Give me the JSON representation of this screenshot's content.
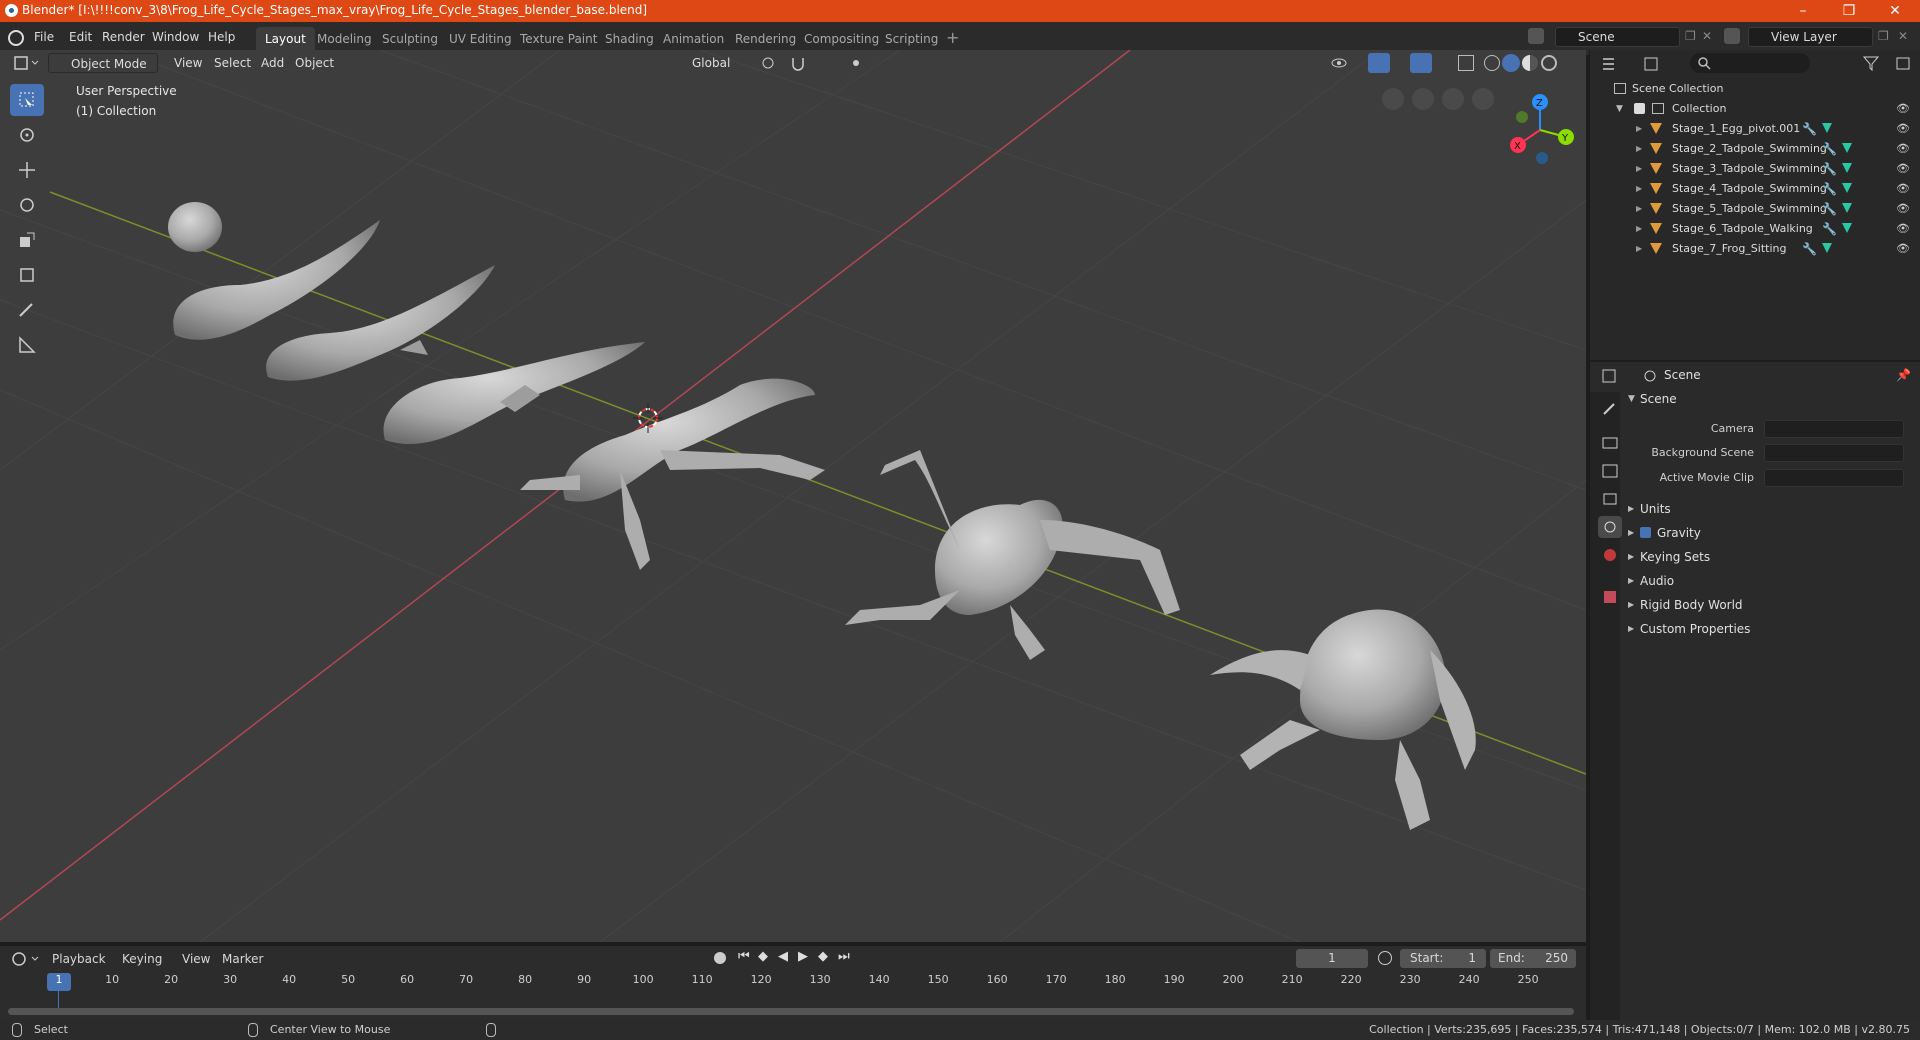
{
  "window": {
    "title": "Blender* [I:\\!!!!conv_3\\8\\Frog_Life_Cycle_Stages_max_vray\\Frog_Life_Cycle_Stages_blender_base.blend]",
    "minimize": "–",
    "maximize": "❐",
    "close": "✕"
  },
  "menu": {
    "items": [
      "File",
      "Edit",
      "Render",
      "Window",
      "Help"
    ]
  },
  "workspaces": [
    "Layout",
    "Modeling",
    "Sculpting",
    "UV Editing",
    "Texture Paint",
    "Shading",
    "Animation",
    "Rendering",
    "Compositing",
    "Scripting"
  ],
  "workspace_add": "+",
  "scene_selector": {
    "value": "Scene"
  },
  "view_layer_selector": {
    "value": "View Layer"
  },
  "viewport_header": {
    "mode": "Object Mode",
    "menus": [
      "View",
      "Select",
      "Add",
      "Object"
    ],
    "transform_orientation": "Global"
  },
  "viewport": {
    "perspective_label": "User Perspective",
    "collection_label": "(1) Collection",
    "gizmo_axes": {
      "x": "X",
      "y": "Y",
      "z": "Z"
    }
  },
  "timeline": {
    "menus": [
      "Playback",
      "Keying",
      "View",
      "Marker"
    ],
    "current_frame": "1",
    "start_label": "Start:",
    "start_value": "1",
    "end_label": "End:",
    "end_value": "250",
    "ticks": [
      "1",
      "10",
      "20",
      "30",
      "40",
      "50",
      "60",
      "70",
      "80",
      "90",
      "100",
      "110",
      "120",
      "130",
      "140",
      "150",
      "160",
      "170",
      "180",
      "190",
      "200",
      "210",
      "220",
      "230",
      "240",
      "250"
    ]
  },
  "outliner": {
    "root": "Scene Collection",
    "collection": "Collection",
    "objects": [
      "Stage_1_Egg_pivot.001",
      "Stage_2_Tadpole_Swimming",
      "Stage_3_Tadpole_Swimming",
      "Stage_4_Tadpole_Swimming",
      "Stage_5_Tadpole_Swimming",
      "Stage_6_Tadpole_Walking",
      "Stage_7_Frog_Sitting"
    ]
  },
  "properties": {
    "context": "Scene",
    "panel_title": "Scene",
    "camera_label": "Camera",
    "background_scene_label": "Background Scene",
    "active_movie_clip_label": "Active Movie Clip",
    "sections": [
      "Units",
      "Gravity",
      "Keying Sets",
      "Audio",
      "Rigid Body World",
      "Custom Properties"
    ]
  },
  "statusbar": {
    "left_action": "Select",
    "middle_action": "Center View to Mouse",
    "stats": "Collection | Verts:235,695 | Faces:235,574 | Tris:471,148 | Objects:0/7 | Mem: 102.0 MB | v2.80.75"
  },
  "colors": {
    "title_bar": "#dd4814",
    "active_tool": "#4772b3",
    "axis_x": "#ff3352",
    "axis_y": "#8bdc00",
    "axis_z": "#2890ff",
    "timeline_playhead": "#4772b3"
  }
}
